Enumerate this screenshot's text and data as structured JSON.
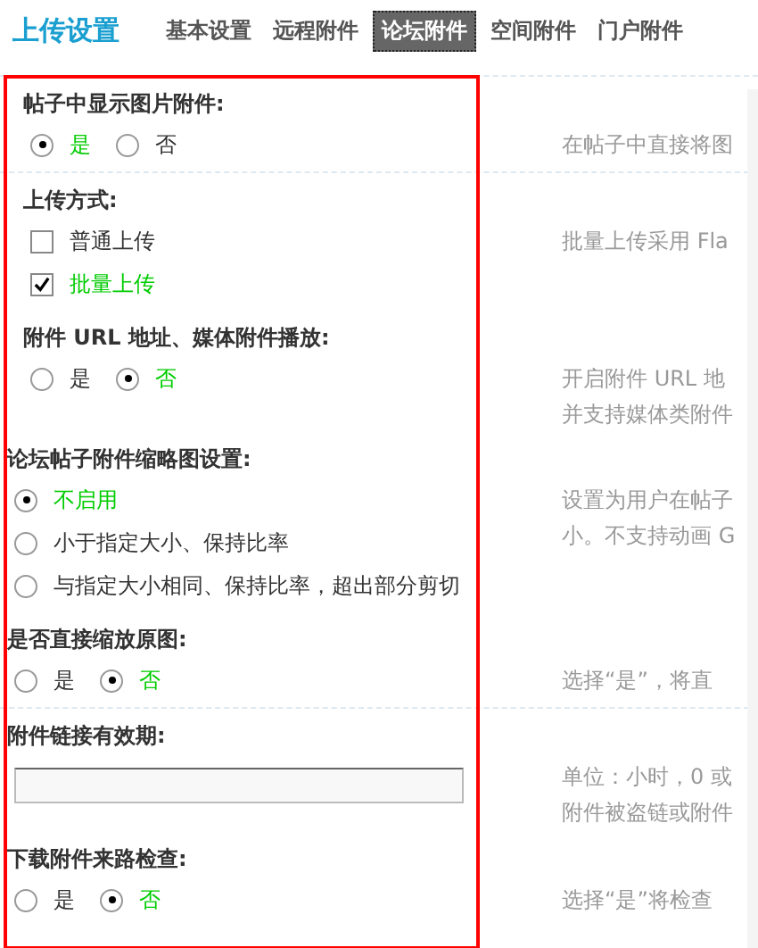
{
  "header": {
    "title": "上传设置"
  },
  "tabs": [
    {
      "label": "基本设置",
      "selected": false
    },
    {
      "label": "远程附件",
      "selected": false
    },
    {
      "label": "论坛附件",
      "selected": true
    },
    {
      "label": "空间附件",
      "selected": false
    },
    {
      "label": "门户附件",
      "selected": false
    }
  ],
  "settings": [
    {
      "title": "帖子中显示图片附件:",
      "kind": "radio",
      "options": [
        {
          "label": "是",
          "selected": true
        },
        {
          "label": "否",
          "selected": false
        }
      ],
      "description": [
        "在帖子中直接将图"
      ]
    },
    {
      "title": "上传方式:",
      "kind": "checkbox",
      "options": [
        {
          "label": "普通上传",
          "checked": false
        },
        {
          "label": "批量上传",
          "checked": true
        }
      ],
      "description": [
        "批量上传采用 Fla"
      ]
    },
    {
      "title": "附件 URL 地址、媒体附件播放:",
      "kind": "radio",
      "options": [
        {
          "label": "是",
          "selected": false
        },
        {
          "label": "否",
          "selected": true
        }
      ],
      "description": [
        "开启附件 URL 地",
        "并支持媒体类附件"
      ]
    },
    {
      "title": "论坛帖子附件缩略图设置:",
      "kind": "radio-list",
      "options": [
        {
          "label": "不启用",
          "selected": true
        },
        {
          "label": "小于指定大小、保持比率",
          "selected": false
        },
        {
          "label": "与指定大小相同、保持比率，超出部分剪切",
          "selected": false
        }
      ],
      "description": [
        "设置为用户在帖子",
        "小。不支持动画 G"
      ]
    },
    {
      "title": "是否直接缩放原图:",
      "kind": "radio",
      "options": [
        {
          "label": "是",
          "selected": false
        },
        {
          "label": "否",
          "selected": true
        }
      ],
      "description": [
        "选择“是”，将直"
      ]
    },
    {
      "title": "附件链接有效期:",
      "kind": "text",
      "description": [
        "单位：小时，0 或",
        "附件被盗链或附件"
      ]
    },
    {
      "title": "下载附件来路检查:",
      "kind": "radio",
      "options": [
        {
          "label": "是",
          "selected": false
        },
        {
          "label": "否",
          "selected": true
        }
      ],
      "description": [
        "选择“是”将检查"
      ]
    }
  ]
}
